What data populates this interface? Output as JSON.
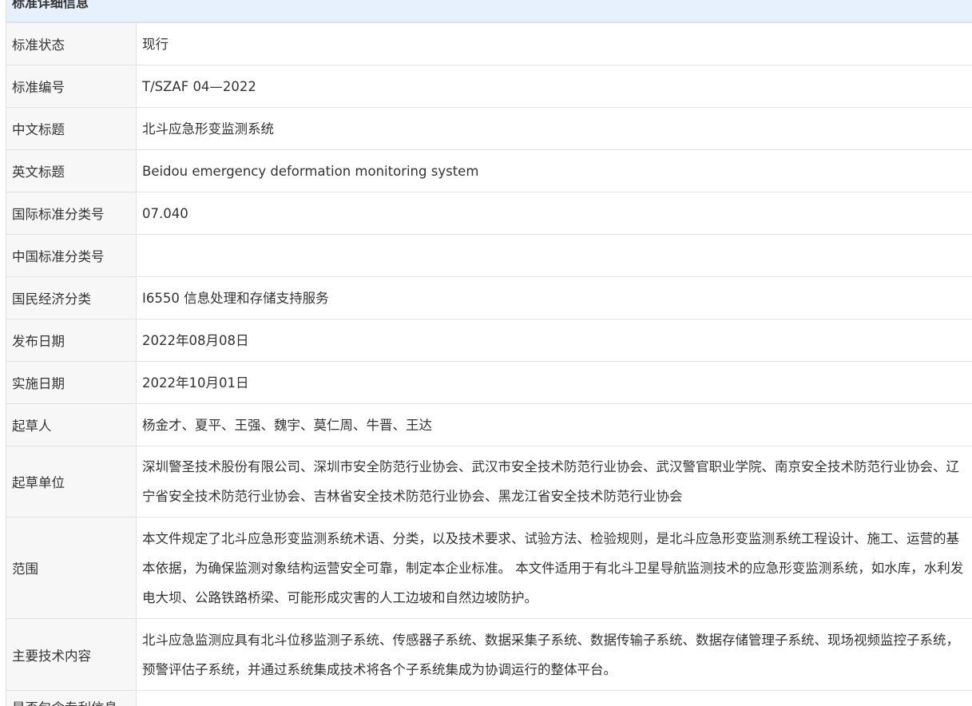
{
  "panel": {
    "title": "标准详细信息"
  },
  "rows": [
    {
      "label": "标准状态",
      "value": "现行"
    },
    {
      "label": "标准编号",
      "value": "T/SZAF 04—2022"
    },
    {
      "label": "中文标题",
      "value": "北斗应急形变监测系统"
    },
    {
      "label": "英文标题",
      "value": "Beidou emergency deformation monitoring system"
    },
    {
      "label": "国际标准分类号",
      "value": "07.040"
    },
    {
      "label": "中国标准分类号",
      "value": ""
    },
    {
      "label": "国民经济分类",
      "value": "I6550 信息处理和存储支持服务"
    },
    {
      "label": "发布日期",
      "value": "2022年08月08日"
    },
    {
      "label": "实施日期",
      "value": "2022年10月01日"
    },
    {
      "label": "起草人",
      "value": "杨金才、夏平、王强、魏宇、莫仁周、牛晋、王达"
    },
    {
      "label": "起草单位",
      "value": "深圳警圣技术股份有限公司、深圳市安全防范行业协会、武汉市安全技术防范行业协会、武汉警官职业学院、南京安全技术防范行业协会、辽宁省安全技术防范行业协会、吉林省安全技术防范行业协会、黑龙江省安全技术防范行业协会"
    },
    {
      "label": "范围",
      "value": "本文件规定了北斗应急形变监测系统术语、分类，以及技术要求、试验方法、检验规则，是北斗应急形变监测系统工程设计、施工、运营的基本依据，为确保监测对象结构运营安全可靠，制定本企业标准。 本文件适用于有北斗卫星导航监测技术的应急形变监测系统，如水库，水利发电大坝、公路铁路桥梁、可能形成灾害的人工边坡和自然边坡防护。"
    },
    {
      "label": "主要技术内容",
      "value": "北斗应急监测应具有北斗位移监测子系统、传感器子系统、数据采集子系统、数据传输子系统、数据存储管理子系统、现场视频监控子系统，预警评估子系统，并通过系统集成技术将各个子系统集成为协调运行的整体平台。"
    },
    {
      "label": "是否包含专利信息",
      "value": ""
    }
  ]
}
